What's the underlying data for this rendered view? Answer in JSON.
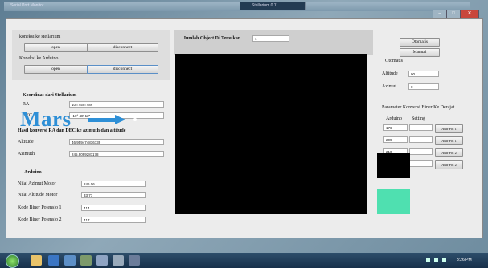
{
  "window": {
    "title": "Serial Port Monitor",
    "taskbar_title": "Stellarium 0.11",
    "close_glyph": "✕",
    "minimize_glyph": "–",
    "maximize_glyph": "□"
  },
  "connect": {
    "stellarium_label": "koneksi ke stellarium",
    "stellarium_open": "open",
    "stellarium_disconnect": "disconnect",
    "arduino_label": "Koneksi ke Arduino",
    "arduino_open": "open",
    "arduino_disconnect": "disconnect"
  },
  "coords": {
    "heading": "Koordinat dari Stellarium",
    "ra_label": "RA",
    "ra_value": "10h 45m 48s",
    "dec_label": "DEC",
    "dec_value": "-10° 48' 12\""
  },
  "conversion": {
    "heading": "Hasil konversi RA dan DEC ke azimuth dan altitude",
    "altitude_label": "Altitude",
    "altitude_value": "46.959474816739",
    "azimuth_label": "Azimuth",
    "azimuth_value": "245.9099281178",
    "arduino_heading": "Arduino",
    "motor_azimuth_label": "Nilai Azimut Motor",
    "motor_azimuth_value": "246.06",
    "motor_altitude_label": "Nilai Altitude Motor",
    "motor_altitude_value": "33.77",
    "pot1_label": "Kode Biner Potensio 1",
    "pot1_value": "414",
    "pot2_label": "Kode Biner Potensio 2",
    "pot2_value": "417"
  },
  "objects": {
    "found_label": "Jumlah Object Di Temukan",
    "found_value": "1"
  },
  "viewport": {
    "object_label": "Mars"
  },
  "mode": {
    "otomatis_button": "Otomatis",
    "manual_button": "Manual",
    "otomatis_label": "Otomatis",
    "altitude_label": "Altitude",
    "altitude_value": "90",
    "azimuth_label": "Azimut",
    "azimuth_value": "0"
  },
  "calibration": {
    "heading": "Parameter Konversi Biner Ke Derajat",
    "col_arduino": "Arduino",
    "col_setting": "Setting",
    "rows": [
      {
        "arduino": "176",
        "setting": "",
        "button": "Atur Pot 1"
      },
      {
        "arduino": "209",
        "setting": "",
        "button": "Atur Pot 1"
      },
      {
        "arduino": "210",
        "setting": "",
        "button": "Atur Pot 2"
      },
      {
        "arduino": "286",
        "setting": "",
        "button": "Atur Pot 2"
      }
    ]
  },
  "status_colors": {
    "indicator_1": "#000000",
    "indicator_2": "#4fe0b0"
  },
  "taskbar": {
    "clock": "3:26 PM"
  }
}
